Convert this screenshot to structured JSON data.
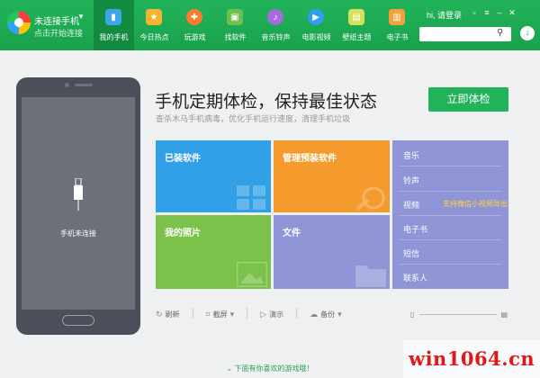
{
  "header": {
    "connection_title": "未连接手机",
    "connection_sub": "点击开始连接",
    "login": "hi, 请登录",
    "nav": [
      {
        "label": "我的手机",
        "icon": "phone-icon",
        "color": "#3aa7e8",
        "active": true
      },
      {
        "label": "今日热点",
        "icon": "hot-news-icon",
        "color": "#f6b52c"
      },
      {
        "label": "玩游戏",
        "icon": "game-icon",
        "color": "#ff7a2b"
      },
      {
        "label": "找软件",
        "icon": "android-icon",
        "color": "#6cc24a"
      },
      {
        "label": "音乐铃声",
        "icon": "music-icon",
        "color": "#a56be0"
      },
      {
        "label": "电影视频",
        "icon": "video-play-icon",
        "color": "#2f9ef0"
      },
      {
        "label": "壁纸主题",
        "icon": "wallpaper-icon",
        "color": "#d7e05a"
      },
      {
        "label": "电子书",
        "icon": "ebook-icon",
        "color": "#f3a23b"
      }
    ]
  },
  "phone": {
    "status": "手机未连接"
  },
  "main": {
    "title": "手机定期体检，保持最佳状态",
    "subtitle": "查杀木马手机病毒，优化手机运行速度，清理手机垃圾",
    "cta": "立即体检"
  },
  "tiles": {
    "apps": "已装软件",
    "preinstall": "管理预装软件",
    "photos": "我的照片",
    "files": "文件"
  },
  "side": {
    "items": [
      "音乐",
      "铃声",
      "视频",
      "电子书",
      "短信",
      "联系人"
    ],
    "video_note": "支持微信小视频导出"
  },
  "toolbar": {
    "refresh": "刷新",
    "screenshot": "截屏",
    "present": "演示",
    "backup": "备份"
  },
  "footer": {
    "hint": "下面有你喜欢的游戏哦！",
    "watermark": "win1064.cn"
  }
}
